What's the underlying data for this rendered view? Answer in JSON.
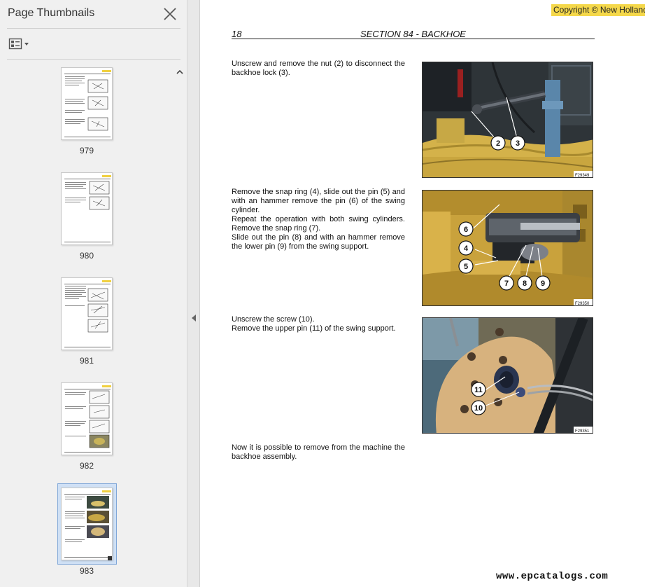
{
  "sidebar": {
    "title": "Page Thumbnails",
    "close_icon": "close-icon",
    "options_icon": "thumbnail-options-icon",
    "thumbnails": [
      {
        "label": "979"
      },
      {
        "label": "980"
      },
      {
        "label": "981"
      },
      {
        "label": "982"
      },
      {
        "label": "983",
        "selected": true
      }
    ]
  },
  "document": {
    "copyright": "Copyright © New Holland",
    "page_number": "18",
    "section_title": "SECTION 84 - BACKHOE",
    "steps": [
      {
        "text": "Unscrew and remove the nut (2) to disconnect the backhoe lock (3).",
        "figure_code": "F29349",
        "callouts": [
          "2",
          "3"
        ]
      },
      {
        "text": "Remove the snap ring (4), slide out the pin (5) and with an hammer remove the pin (6) of the swing cylinder.\nRepeat the operation with both swing cylinders. Remove the snap ring (7).\nSlide out the pin (8) and with an hammer remove the lower pin (9) from the swing support.",
        "figure_code": "F29350",
        "callouts": [
          "6",
          "4",
          "5",
          "7",
          "8",
          "9"
        ]
      },
      {
        "text": "Unscrew the screw (10).\nRemove the upper pin (11) of the swing support.",
        "figure_code": "F29351",
        "callouts": [
          "11",
          "10"
        ]
      },
      {
        "text": "Now it is possible to remove from the machine the backhoe assembly."
      }
    ]
  },
  "watermark": "www.epcatalogs.com",
  "colors": {
    "copyright_bg": "#f5d84a",
    "machine_yellow": "#d9b84a",
    "selection_bg": "#cfe0f5"
  }
}
